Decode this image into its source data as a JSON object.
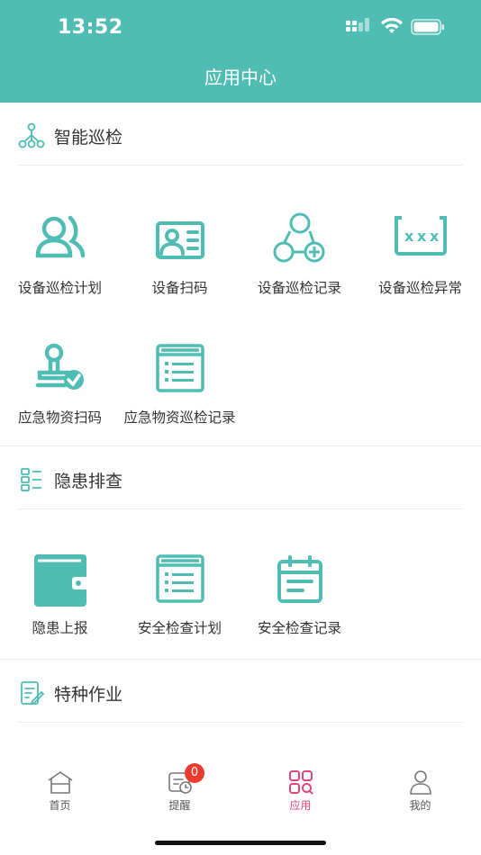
{
  "status_bar": {
    "time": "13:52"
  },
  "header": {
    "title": "应用中心"
  },
  "sections": [
    {
      "title": "智能巡检",
      "icon": "network-icon",
      "items": [
        {
          "label": "设备巡检计划",
          "icon": "users-icon"
        },
        {
          "label": "设备扫码",
          "icon": "id-card-icon"
        },
        {
          "label": "设备巡检记录",
          "icon": "circles-add-icon"
        },
        {
          "label": "设备巡检异常",
          "icon": "password-box-icon"
        },
        {
          "label": "应急物资扫码",
          "icon": "stamp-check-icon"
        },
        {
          "label": "应急物资巡检记录",
          "icon": "list-window-icon"
        }
      ]
    },
    {
      "title": "隐患排查",
      "icon": "list-grid-icon",
      "items": [
        {
          "label": "隐患上报",
          "icon": "wallet-icon"
        },
        {
          "label": "安全检查计划",
          "icon": "list-window-icon"
        },
        {
          "label": "安全检查记录",
          "icon": "calendar-icon"
        }
      ]
    },
    {
      "title": "特种作业",
      "icon": "edit-doc-icon",
      "items": []
    }
  ],
  "tabbar": {
    "items": [
      {
        "label": "首页",
        "icon": "home-icon"
      },
      {
        "label": "提醒",
        "icon": "reminder-icon",
        "badge": "0"
      },
      {
        "label": "应用",
        "icon": "apps-icon",
        "active": true
      },
      {
        "label": "我的",
        "icon": "user-icon"
      }
    ]
  },
  "colors": {
    "primary": "#4fbdb3",
    "active_tab": "#e0457b",
    "badge": "#ee3b2f"
  }
}
